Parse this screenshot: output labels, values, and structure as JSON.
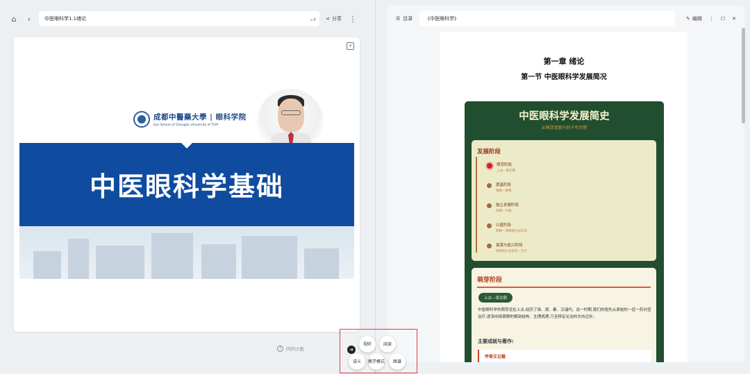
{
  "left": {
    "doc_title": "中医眼科学1.1绪论",
    "share_label": "分享",
    "ask_placeholder": "问问小鱼"
  },
  "slide": {
    "university_cn": "成都中醫藥大學 | 眼科学院",
    "university_en": "Eye School of Chengdu University of TCM",
    "title": "中医眼科学基础"
  },
  "right": {
    "toc_label": "目录",
    "book_title": "《中医眼科学》",
    "edit_label": "编辑",
    "chapter_title": "第一章 绪论",
    "section_title": "第一节  中医眼科学发展简况",
    "card": {
      "title": "中医眼科学发展简史",
      "subtitle": "从萌芽到复兴的千年历程",
      "stages_heading": "发展阶段",
      "stages": [
        {
          "name": "萌芽阶段",
          "period": "上古—南北朝",
          "active": true
        },
        {
          "name": "奠基阶段",
          "period": "隋朝—唐朝",
          "active": false
        },
        {
          "name": "独立发展阶段",
          "period": "宋朝—元朝",
          "active": false
        },
        {
          "name": "兴盛阶段",
          "period": "明朝—清朝鸦片战争前",
          "active": false
        },
        {
          "name": "衰落与复兴阶段",
          "period": "清朝鸦片战争后—至今",
          "active": false
        }
      ],
      "detail_heading": "萌芽阶段",
      "detail_period": "上古—南北朝",
      "detail_text": "中医眼科学的萌芽远在上古,经历了商、周、秦、汉诸代。这一时期,我们的祖先从原始的一症一药对症治疗,逐渐向探索眼的解剖结构、生理病理,乃至辨证论治的方向迈步。",
      "achievements_heading": "主要成就与著作:",
      "achievement_item": "甲骨文记载"
    }
  },
  "modes": {
    "b1": "视听",
    "b2": "阅读",
    "b3": "讲义",
    "b4": "教学模式",
    "b5": "图谱"
  },
  "colors": {
    "slide_band": "#0f4ca0",
    "card_green": "#214e2e",
    "highlight_border": "#e03a3a"
  }
}
